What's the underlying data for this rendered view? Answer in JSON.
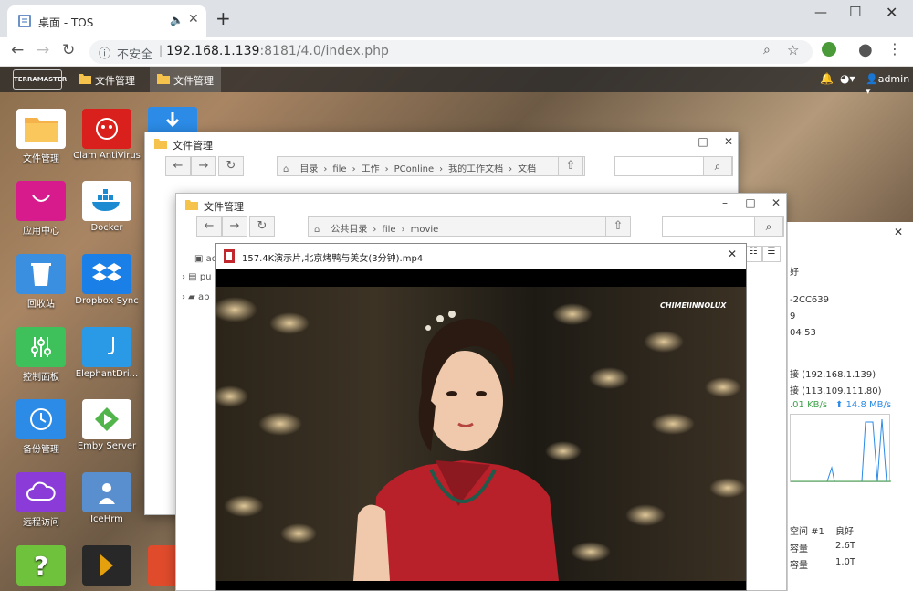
{
  "browser": {
    "tab_title": "桌面 - TOS",
    "new_tab": "+",
    "security": "不安全",
    "url_host": "192.168.1.139",
    "url_path": ":8181/4.0/index.php"
  },
  "taskbar": {
    "logo": "TERRAMASTER",
    "items": [
      {
        "label": "文件管理"
      },
      {
        "label": "文件管理"
      }
    ],
    "user": "admin"
  },
  "desktop_icons": [
    {
      "label": "文件管理",
      "color": "#f6c25a"
    },
    {
      "label": "Clam AntiVirus",
      "color": "#d9201c"
    },
    {
      "label": "应用中心",
      "color": "#d81b8c"
    },
    {
      "label": "Docker",
      "color": "#ffffff"
    },
    {
      "label": "回收站",
      "color": "#3b8fe0"
    },
    {
      "label": "Dropbox Sync",
      "color": "#1a7fe6"
    },
    {
      "label": "控制面板",
      "color": "#3ec05a"
    },
    {
      "label": "ElephantDri...",
      "color": "#2b9ae6"
    },
    {
      "label": "备份管理",
      "color": "#2b8be6"
    },
    {
      "label": "Emby Server",
      "color": "#ffffff"
    },
    {
      "label": "远程访问",
      "color": "#8a3bd8"
    },
    {
      "label": "IceHrm",
      "color": "#5a8fcf"
    },
    {
      "label": "?",
      "color": "#6fc23c"
    }
  ],
  "window1": {
    "title": "文件管理",
    "breadcrumb": [
      "目录",
      "file",
      "工作",
      "PConline",
      "我的工作文档",
      "文档"
    ]
  },
  "window2": {
    "title": "文件管理",
    "breadcrumb": [
      "公共目录",
      "file",
      "movie"
    ],
    "tree": [
      "ad",
      "pu",
      "ap"
    ]
  },
  "video": {
    "title": "157.4K演示片,北京烤鸭与美女(3分钟).mp4",
    "watermark": "CHIMEIINNOLUX"
  },
  "right_panel": {
    "lines": [
      "好",
      "-2CC639",
      "9",
      "04:53",
      "接 (192.168.1.139)",
      "接 (113.109.111.80)",
      ".01 KB/s",
      "14.8 MB/s",
      "空间 #1",
      "良好",
      "容量",
      "2.6T",
      "容量",
      "1.0T"
    ]
  },
  "colors": {
    "accent": "#2b8be6",
    "taskbar": "#2a2a2a"
  }
}
